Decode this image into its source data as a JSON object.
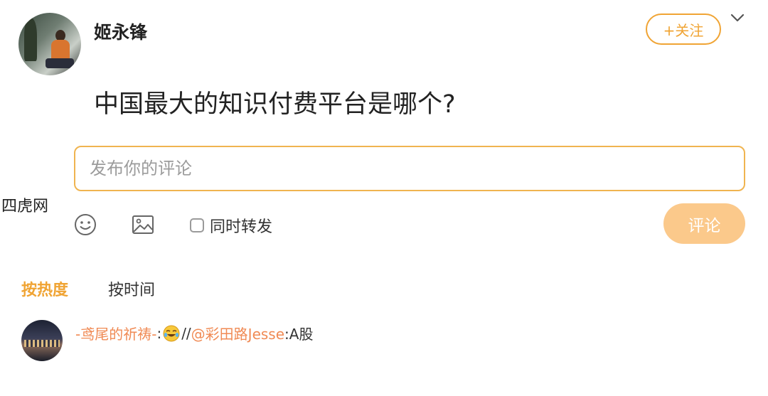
{
  "post": {
    "author": {
      "name": "姬永锋"
    },
    "follow_label": "+关注",
    "title": "中国最大的知识付费平台是哪个?"
  },
  "comment_box": {
    "placeholder": "发布你的评论",
    "sync_label": "同时转发",
    "sync_checked": false,
    "submit_label": "评论"
  },
  "watermark": "四虎网",
  "sort": {
    "hot_label": "按热度",
    "time_label": "按时间",
    "active": "hot"
  },
  "comments": [
    {
      "author": "-鸢尾的祈祷-",
      "colon": ":",
      "slashes": "//",
      "mention": "@彩田路Jesse",
      "after_mention": ":A股"
    }
  ],
  "colors": {
    "accent": "#f0a434",
    "link": "#f08a54",
    "submit_disabled": "#fbc98b"
  },
  "icons": [
    "chevron-down-icon",
    "smiley-icon",
    "image-icon",
    "crying-laugh-emoji-icon"
  ]
}
